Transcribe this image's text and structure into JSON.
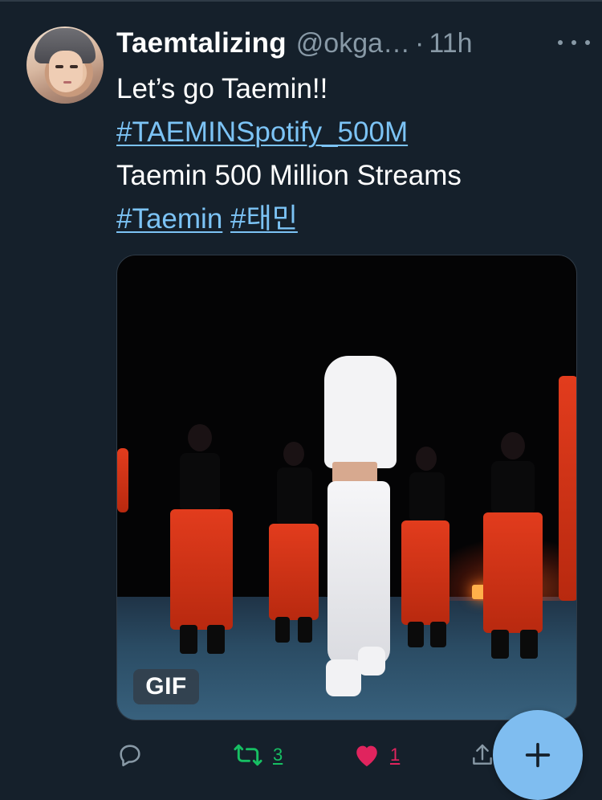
{
  "tweet": {
    "display_name": "Taemtalizing",
    "handle": "@okga…",
    "separator": "·",
    "time": "11h",
    "text_line1": "Let’s go Taemin!!",
    "hashtag_main": "#TAEMINSpotify_500M",
    "text_line3": "Taemin 500 Million Streams",
    "hashtag_1": "#Taemin",
    "hashtag_2": "#태민"
  },
  "media": {
    "badge": "GIF"
  },
  "actions": {
    "reply_icon": "reply-icon",
    "retweet_icon": "retweet-icon",
    "retweet_count": "3",
    "like_icon": "heart-icon",
    "like_count": "1",
    "share_icon": "share-icon"
  },
  "fab": {
    "icon": "plus-icon"
  },
  "colors": {
    "background": "#15202b",
    "link": "#7cc3f5",
    "muted": "#8899a6",
    "retweet": "#17bf63",
    "like": "#e0245e",
    "fab": "#7fbdf0"
  }
}
